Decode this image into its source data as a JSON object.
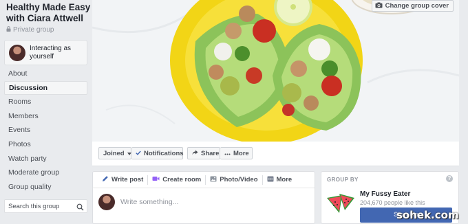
{
  "group": {
    "title": "Healthy Made Easy with Ciara Attwell",
    "privacy": "Private group"
  },
  "acting_as": {
    "label": "Interacting as yourself"
  },
  "nav": {
    "items": [
      {
        "label": "About",
        "active": false
      },
      {
        "label": "Discussion",
        "active": true
      },
      {
        "label": "Rooms",
        "active": false
      },
      {
        "label": "Members",
        "active": false
      },
      {
        "label": "Events",
        "active": false
      },
      {
        "label": "Photos",
        "active": false
      },
      {
        "label": "Watch party",
        "active": false
      },
      {
        "label": "Moderate group",
        "active": false
      },
      {
        "label": "Group quality",
        "active": false
      }
    ]
  },
  "search": {
    "placeholder": "Search this group"
  },
  "cover": {
    "change_label": "Change group cover"
  },
  "actions": {
    "joined": "Joined",
    "notifications": "Notifications",
    "share": "Share",
    "more": "More"
  },
  "composer": {
    "tabs": [
      "Write post",
      "Create room",
      "Photo/Video",
      "More"
    ],
    "placeholder": "Write something..."
  },
  "group_by": {
    "heading": "GROUP BY",
    "info": "?",
    "page_name": "My Fussy Eater",
    "likes": "204,670 people like this",
    "signup": "Sign Up"
  },
  "watermark": "sohek.com",
  "colors": {
    "brand_blue": "#4267b2",
    "background": "#e9ebee",
    "check_blue": "#4267b2"
  }
}
